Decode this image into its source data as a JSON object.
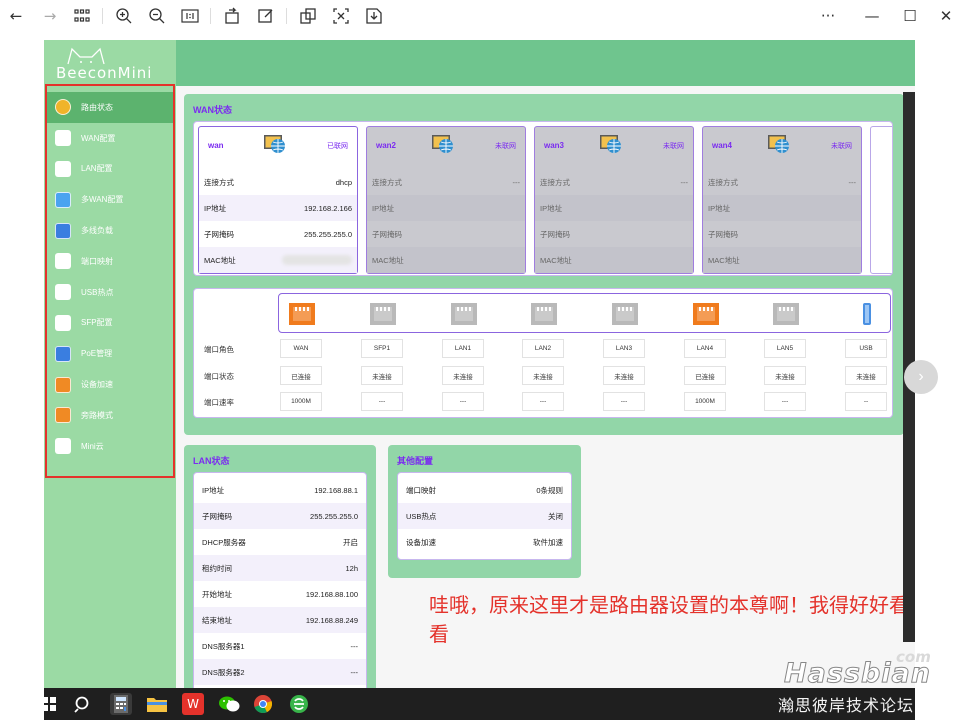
{
  "toolbar": {
    "buttons": [
      "back-icon",
      "forward-icon",
      "grid-view-icon",
      "zoom-in-icon",
      "zoom-out-icon",
      "actual-size-icon",
      "rotate-icon",
      "edit-icon",
      "copy-icon",
      "crop-icon",
      "save-icon"
    ],
    "more": "···",
    "minimize": "—",
    "maximize": "☐",
    "close": "✕"
  },
  "logo": {
    "text": "BeeconMini"
  },
  "sidebar": {
    "items": [
      {
        "label": "路由状态",
        "icon": "status-icon",
        "color": "#f0b429"
      },
      {
        "label": "WAN配置",
        "icon": "wan-icon",
        "color": "#ffffff"
      },
      {
        "label": "LAN配置",
        "icon": "lan-icon",
        "color": "#ffffff"
      },
      {
        "label": "多WAN配置",
        "icon": "multi-wan-icon",
        "color": "#4aa3f0"
      },
      {
        "label": "多线负载",
        "icon": "load-balance-icon",
        "color": "#3a7ee0"
      },
      {
        "label": "端口映射",
        "icon": "port-map-icon",
        "color": "#ffffff"
      },
      {
        "label": "USB热点",
        "icon": "usb-icon",
        "color": "#ffffff"
      },
      {
        "label": "SFP配置",
        "icon": "sfp-icon",
        "color": "#ffffff"
      },
      {
        "label": "PoE管理",
        "icon": "poe-icon",
        "color": "#3a7ee0"
      },
      {
        "label": "设备加速",
        "icon": "rocket-icon",
        "color": "#f08a24"
      },
      {
        "label": "旁路模式",
        "icon": "bypass-icon",
        "color": "#f08a24"
      },
      {
        "label": "Mini云",
        "icon": "cloud-icon",
        "color": "#ffffff"
      }
    ]
  },
  "wan_panel": {
    "title": "WAN状态",
    "row_labels": [
      "连接方式",
      "IP地址",
      "子网掩码",
      "MAC地址"
    ],
    "cards": [
      {
        "name": "wan",
        "status": "已联网",
        "values": [
          "dhcp",
          "192.168.2.166",
          "255.255.255.0",
          ""
        ]
      },
      {
        "name": "wan2",
        "status": "未联网",
        "values": [
          "---",
          "",
          "",
          ""
        ]
      },
      {
        "name": "wan3",
        "status": "未联网",
        "values": [
          "---",
          "",
          "",
          ""
        ]
      },
      {
        "name": "wan4",
        "status": "未联网",
        "values": [
          "---",
          "",
          "",
          ""
        ]
      }
    ]
  },
  "ports": {
    "row_labels": [
      "端口角色",
      "端口状态",
      "端口速率"
    ],
    "list": [
      {
        "role": "WAN",
        "status": "已连接",
        "speed": "1000M",
        "color": "#f07b1d"
      },
      {
        "role": "SFP1",
        "status": "未连接",
        "speed": "---",
        "color": "#b9b9b9"
      },
      {
        "role": "LAN1",
        "status": "未连接",
        "speed": "---",
        "color": "#b9b9b9"
      },
      {
        "role": "LAN2",
        "status": "未连接",
        "speed": "---",
        "color": "#b9b9b9"
      },
      {
        "role": "LAN3",
        "status": "未连接",
        "speed": "---",
        "color": "#b9b9b9"
      },
      {
        "role": "LAN4",
        "status": "已连接",
        "speed": "1000M",
        "color": "#f07b1d"
      },
      {
        "role": "LAN5",
        "status": "未连接",
        "speed": "---",
        "color": "#b9b9b9"
      },
      {
        "role": "USB",
        "status": "未连接",
        "speed": "--",
        "color": "#4a90e2"
      }
    ]
  },
  "lan_panel": {
    "title": "LAN状态",
    "rows": [
      {
        "label": "IP地址",
        "value": "192.168.88.1"
      },
      {
        "label": "子网掩码",
        "value": "255.255.255.0"
      },
      {
        "label": "DHCP服务器",
        "value": "开启"
      },
      {
        "label": "租约时间",
        "value": "12h"
      },
      {
        "label": "开始地址",
        "value": "192.168.88.100"
      },
      {
        "label": "结束地址",
        "value": "192.168.88.249"
      },
      {
        "label": "DNS服务器1",
        "value": "---"
      },
      {
        "label": "DNS服务器2",
        "value": "---"
      }
    ]
  },
  "other_panel": {
    "title": "其他配置",
    "rows": [
      {
        "label": "端口映射",
        "value": "0条规则"
      },
      {
        "label": "USB热点",
        "value": "关闭"
      },
      {
        "label": "设备加速",
        "value": "软件加速"
      }
    ]
  },
  "annotation": "哇哦，原来这里才是路由器设置的本尊啊！我得好好看看",
  "taskbar": {
    "icons": [
      "windows-start-icon",
      "search-icon",
      "calculator-icon",
      "file-explorer-icon",
      "wps-office-icon",
      "wechat-icon",
      "chrome-icon",
      "browser-icon"
    ]
  },
  "watermark": {
    "com": "com",
    "main": "Hassbian",
    "sub": "瀚思彼岸技术论坛"
  },
  "colors": {
    "accent": "#7b2cf0",
    "header_green": "#6fc58e",
    "sidebar_green": "#9bdaa4",
    "panel_green": "#92d6a8",
    "highlight_red": "#e4322b"
  }
}
